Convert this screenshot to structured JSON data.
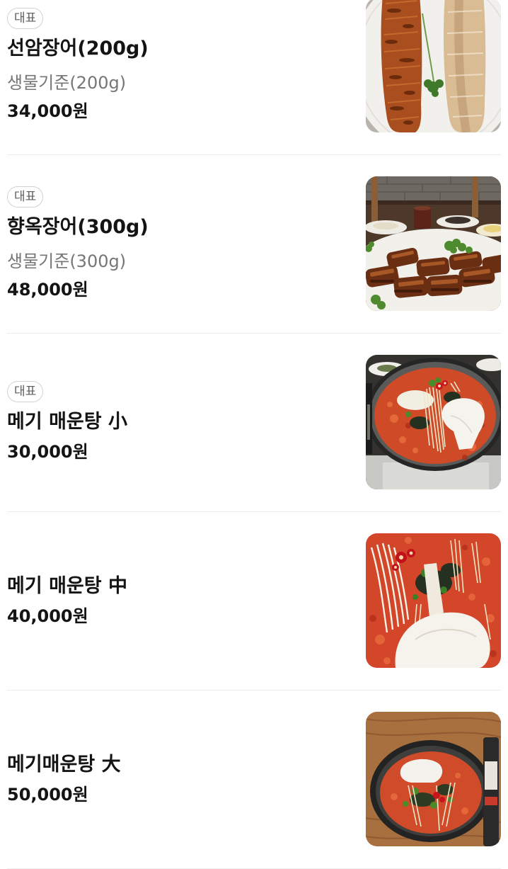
{
  "menu": {
    "items": [
      {
        "badge": "대표",
        "name": "선암장어(200g)",
        "description": "생물기준(200g)",
        "price": "34,000원"
      },
      {
        "badge": "대표",
        "name": "향옥장어(300g)",
        "description": "생물기준(300g)",
        "price": "48,000원"
      },
      {
        "badge": "대표",
        "name": "메기 매운탕 小",
        "price": "30,000원"
      },
      {
        "name": "메기 매운탕 中",
        "price": "40,000원"
      },
      {
        "name": "메기매운탕 大",
        "price": "50,000원"
      }
    ]
  }
}
